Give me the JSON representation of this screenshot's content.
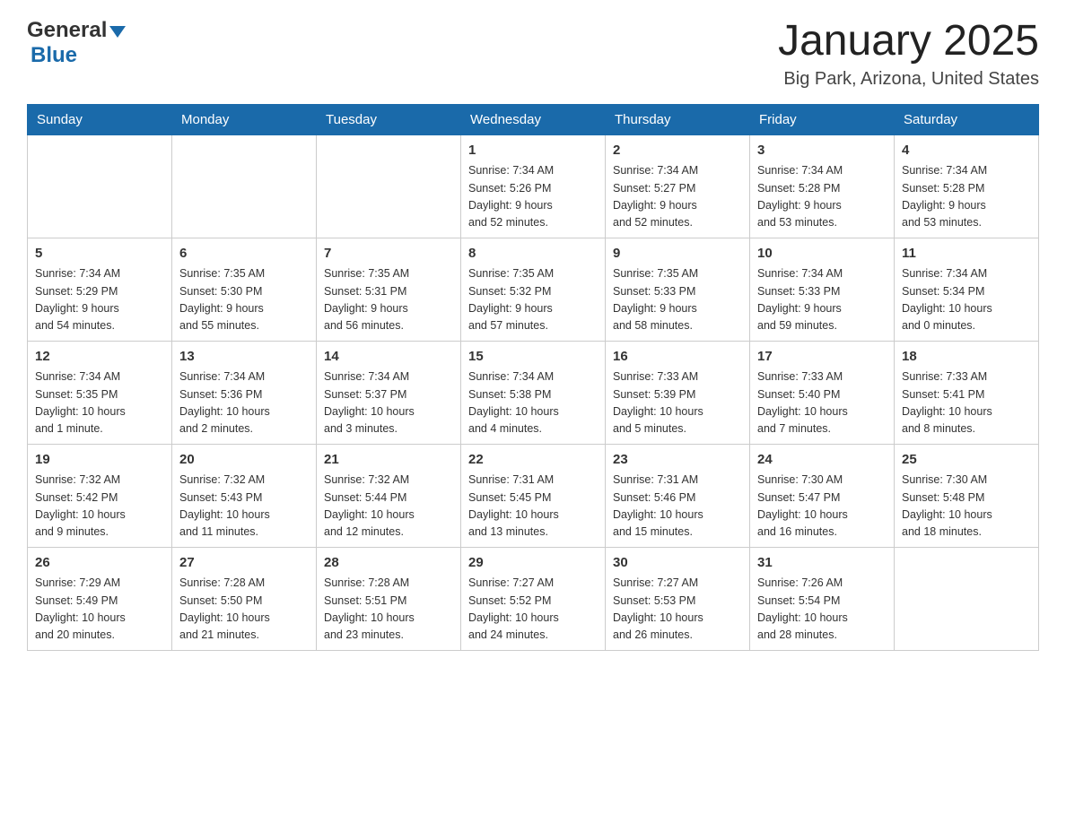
{
  "header": {
    "logo_general": "General",
    "logo_blue": "Blue",
    "title": "January 2025",
    "subtitle": "Big Park, Arizona, United States"
  },
  "days_of_week": [
    "Sunday",
    "Monday",
    "Tuesday",
    "Wednesday",
    "Thursday",
    "Friday",
    "Saturday"
  ],
  "weeks": [
    [
      {
        "day": "",
        "info": ""
      },
      {
        "day": "",
        "info": ""
      },
      {
        "day": "",
        "info": ""
      },
      {
        "day": "1",
        "info": "Sunrise: 7:34 AM\nSunset: 5:26 PM\nDaylight: 9 hours\nand 52 minutes."
      },
      {
        "day": "2",
        "info": "Sunrise: 7:34 AM\nSunset: 5:27 PM\nDaylight: 9 hours\nand 52 minutes."
      },
      {
        "day": "3",
        "info": "Sunrise: 7:34 AM\nSunset: 5:28 PM\nDaylight: 9 hours\nand 53 minutes."
      },
      {
        "day": "4",
        "info": "Sunrise: 7:34 AM\nSunset: 5:28 PM\nDaylight: 9 hours\nand 53 minutes."
      }
    ],
    [
      {
        "day": "5",
        "info": "Sunrise: 7:34 AM\nSunset: 5:29 PM\nDaylight: 9 hours\nand 54 minutes."
      },
      {
        "day": "6",
        "info": "Sunrise: 7:35 AM\nSunset: 5:30 PM\nDaylight: 9 hours\nand 55 minutes."
      },
      {
        "day": "7",
        "info": "Sunrise: 7:35 AM\nSunset: 5:31 PM\nDaylight: 9 hours\nand 56 minutes."
      },
      {
        "day": "8",
        "info": "Sunrise: 7:35 AM\nSunset: 5:32 PM\nDaylight: 9 hours\nand 57 minutes."
      },
      {
        "day": "9",
        "info": "Sunrise: 7:35 AM\nSunset: 5:33 PM\nDaylight: 9 hours\nand 58 minutes."
      },
      {
        "day": "10",
        "info": "Sunrise: 7:34 AM\nSunset: 5:33 PM\nDaylight: 9 hours\nand 59 minutes."
      },
      {
        "day": "11",
        "info": "Sunrise: 7:34 AM\nSunset: 5:34 PM\nDaylight: 10 hours\nand 0 minutes."
      }
    ],
    [
      {
        "day": "12",
        "info": "Sunrise: 7:34 AM\nSunset: 5:35 PM\nDaylight: 10 hours\nand 1 minute."
      },
      {
        "day": "13",
        "info": "Sunrise: 7:34 AM\nSunset: 5:36 PM\nDaylight: 10 hours\nand 2 minutes."
      },
      {
        "day": "14",
        "info": "Sunrise: 7:34 AM\nSunset: 5:37 PM\nDaylight: 10 hours\nand 3 minutes."
      },
      {
        "day": "15",
        "info": "Sunrise: 7:34 AM\nSunset: 5:38 PM\nDaylight: 10 hours\nand 4 minutes."
      },
      {
        "day": "16",
        "info": "Sunrise: 7:33 AM\nSunset: 5:39 PM\nDaylight: 10 hours\nand 5 minutes."
      },
      {
        "day": "17",
        "info": "Sunrise: 7:33 AM\nSunset: 5:40 PM\nDaylight: 10 hours\nand 7 minutes."
      },
      {
        "day": "18",
        "info": "Sunrise: 7:33 AM\nSunset: 5:41 PM\nDaylight: 10 hours\nand 8 minutes."
      }
    ],
    [
      {
        "day": "19",
        "info": "Sunrise: 7:32 AM\nSunset: 5:42 PM\nDaylight: 10 hours\nand 9 minutes."
      },
      {
        "day": "20",
        "info": "Sunrise: 7:32 AM\nSunset: 5:43 PM\nDaylight: 10 hours\nand 11 minutes."
      },
      {
        "day": "21",
        "info": "Sunrise: 7:32 AM\nSunset: 5:44 PM\nDaylight: 10 hours\nand 12 minutes."
      },
      {
        "day": "22",
        "info": "Sunrise: 7:31 AM\nSunset: 5:45 PM\nDaylight: 10 hours\nand 13 minutes."
      },
      {
        "day": "23",
        "info": "Sunrise: 7:31 AM\nSunset: 5:46 PM\nDaylight: 10 hours\nand 15 minutes."
      },
      {
        "day": "24",
        "info": "Sunrise: 7:30 AM\nSunset: 5:47 PM\nDaylight: 10 hours\nand 16 minutes."
      },
      {
        "day": "25",
        "info": "Sunrise: 7:30 AM\nSunset: 5:48 PM\nDaylight: 10 hours\nand 18 minutes."
      }
    ],
    [
      {
        "day": "26",
        "info": "Sunrise: 7:29 AM\nSunset: 5:49 PM\nDaylight: 10 hours\nand 20 minutes."
      },
      {
        "day": "27",
        "info": "Sunrise: 7:28 AM\nSunset: 5:50 PM\nDaylight: 10 hours\nand 21 minutes."
      },
      {
        "day": "28",
        "info": "Sunrise: 7:28 AM\nSunset: 5:51 PM\nDaylight: 10 hours\nand 23 minutes."
      },
      {
        "day": "29",
        "info": "Sunrise: 7:27 AM\nSunset: 5:52 PM\nDaylight: 10 hours\nand 24 minutes."
      },
      {
        "day": "30",
        "info": "Sunrise: 7:27 AM\nSunset: 5:53 PM\nDaylight: 10 hours\nand 26 minutes."
      },
      {
        "day": "31",
        "info": "Sunrise: 7:26 AM\nSunset: 5:54 PM\nDaylight: 10 hours\nand 28 minutes."
      },
      {
        "day": "",
        "info": ""
      }
    ]
  ]
}
